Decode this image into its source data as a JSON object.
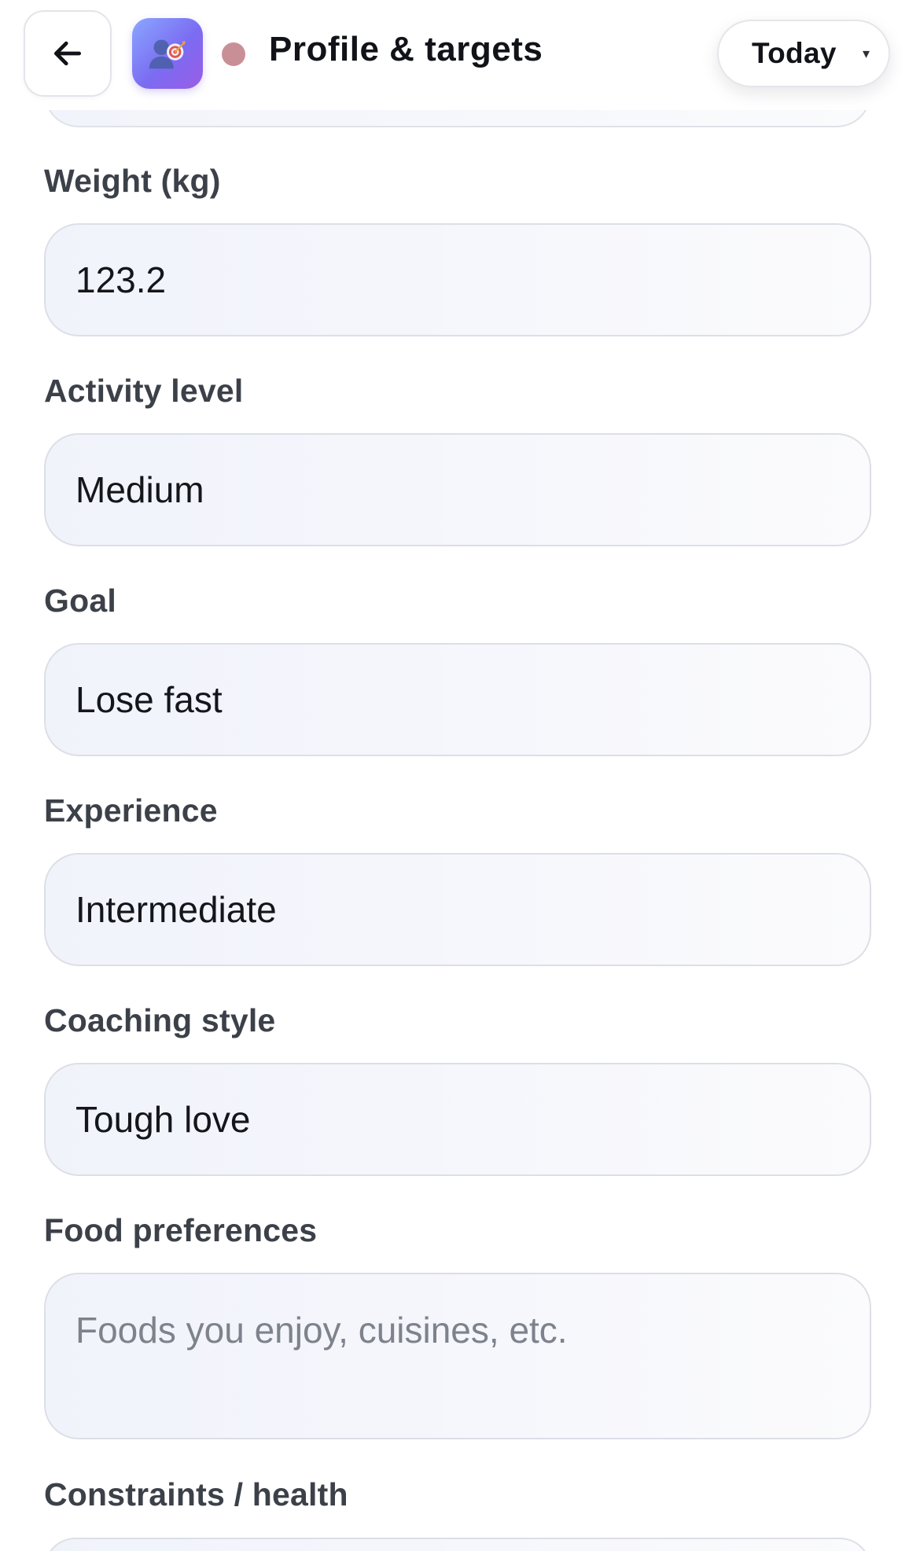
{
  "header": {
    "back_icon": "arrow-left-icon",
    "app_icon": "profile-target-icon",
    "status_color": "#c98f97",
    "title": "Profile & targets",
    "date_select": {
      "value": "Today",
      "caret": "▾"
    }
  },
  "form": {
    "fields": [
      {
        "label": "Weight (kg)",
        "value": "123.2"
      },
      {
        "label": "Activity level",
        "value": "Medium"
      },
      {
        "label": "Goal",
        "value": "Lose fast"
      },
      {
        "label": "Experience",
        "value": "Intermediate"
      },
      {
        "label": "Coaching style",
        "value": "Tough love"
      }
    ],
    "food_preferences": {
      "label": "Food preferences",
      "value": "",
      "placeholder": "Foods you enjoy, cuisines, etc."
    },
    "constraints": {
      "label": "Constraints / health"
    }
  }
}
